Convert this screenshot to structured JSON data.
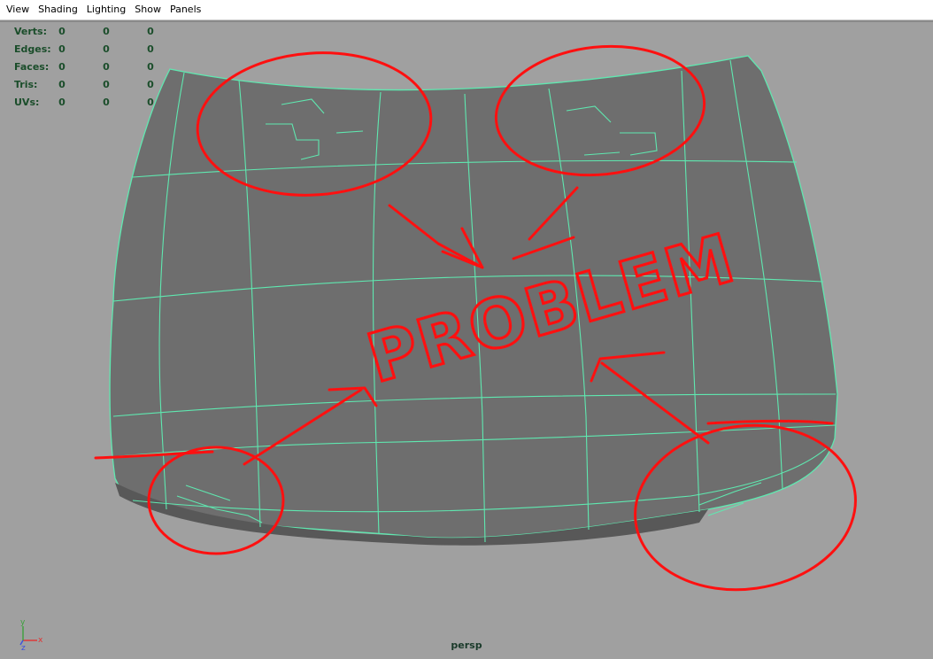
{
  "menu": {
    "items": [
      {
        "label": "View"
      },
      {
        "label": "Shading"
      },
      {
        "label": "Lighting"
      },
      {
        "label": "Show"
      },
      {
        "label": "Panels"
      }
    ]
  },
  "hud": {
    "rows": [
      {
        "label": "Verts:",
        "values": [
          "0",
          "0",
          "0"
        ]
      },
      {
        "label": "Edges:",
        "values": [
          "0",
          "0",
          "0"
        ]
      },
      {
        "label": "Faces:",
        "values": [
          "0",
          "0",
          "0"
        ]
      },
      {
        "label": "Tris:",
        "values": [
          "0",
          "0",
          "0"
        ]
      },
      {
        "label": "UVs:",
        "values": [
          "0",
          "0",
          "0"
        ]
      }
    ]
  },
  "viewport": {
    "camera_label": "persp",
    "background_color": "#a0a0a0",
    "mesh_color": "#6e6e6e",
    "wire_color": "#5fe8b0",
    "annotation_color": "#ff1010"
  },
  "annotation": {
    "text": "PROBLEM"
  },
  "axis_gizmo": {
    "x_label": "x",
    "y_label": "y",
    "z_label": "z"
  }
}
